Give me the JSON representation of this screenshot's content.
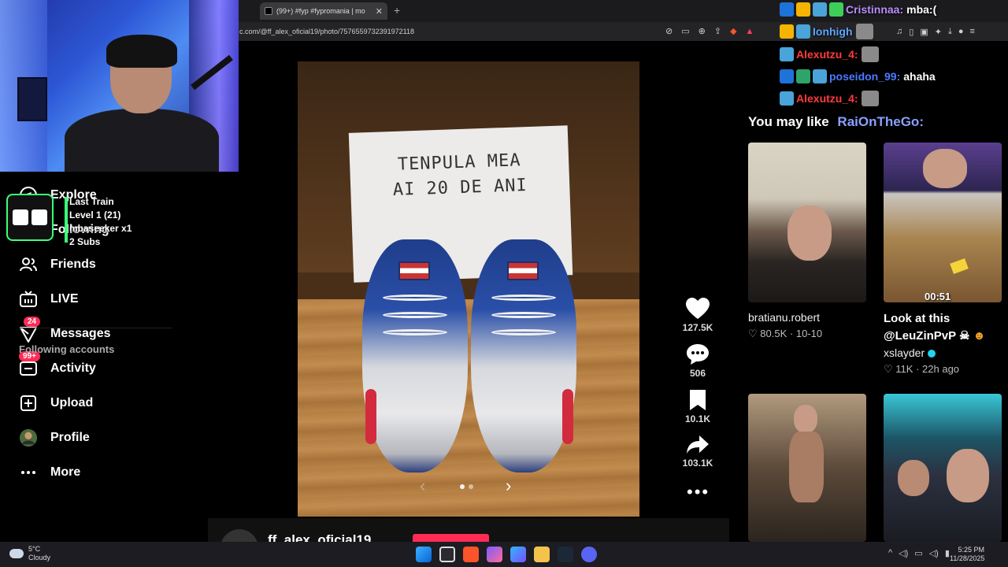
{
  "browser": {
    "tab_title": "(99+) #fyp #fypromania | mo",
    "tab_close": "✕",
    "new_tab": "+",
    "url": "c.com/@ff_alex_oficial19/photo/7576559732391972118"
  },
  "nav": {
    "items": [
      {
        "label": "Explore",
        "icon": "compass-icon"
      },
      {
        "label": "Following",
        "icon": "following-icon"
      },
      {
        "label": "Friends",
        "icon": "friends-icon"
      },
      {
        "label": "LIVE",
        "icon": "live-icon"
      },
      {
        "label": "Messages",
        "icon": "messages-icon",
        "badge": "24"
      },
      {
        "label": "Activity",
        "icon": "activity-icon",
        "badge": "99+"
      },
      {
        "label": "Upload",
        "icon": "upload-icon"
      },
      {
        "label": "Profile",
        "icon": "profile-avatar"
      },
      {
        "label": "More",
        "icon": "more-icon"
      }
    ],
    "following_accounts": "Following accounts"
  },
  "alert": {
    "line1": "Last Train",
    "line2": "Level 1 (21)",
    "line3": "mbaseeker x1",
    "line4": "2 Subs"
  },
  "post": {
    "sign_line1": "TENPULA MEA",
    "sign_line2": "AI 20 DE ANI",
    "likes": "127.5K",
    "comments": "506",
    "saves": "10.1K",
    "shares": "103.1K",
    "author": "ff_alex_oficial19",
    "photo_index": 1,
    "photo_count": 2
  },
  "chat": [
    {
      "user": "Cristinnaa:",
      "msg": "mba:(",
      "color": "#b98cff"
    },
    {
      "user": "Ionhigh",
      "msg": "",
      "color": "#5ea4ff"
    },
    {
      "user": "Alexutzu_4:",
      "msg": "",
      "color": "#ff3b3b"
    },
    {
      "user": "poseidon_99:",
      "msg": "ahaha",
      "color": "#4a7bff"
    },
    {
      "user": "Alexutzu_4:",
      "msg": "",
      "color": "#ff3b3b"
    }
  ],
  "recommendations": {
    "title": "You may like",
    "chat_overlay_user": "RaiOnTheGo:",
    "items": [
      {
        "author": "bratianu.robert",
        "likes": "80.5K",
        "date": "10-10"
      },
      {
        "title_line1": "Look at this",
        "title_line2": "@LeuZinPvP",
        "author": "xslayder",
        "likes": "11K",
        "date": "22h ago",
        "duration": "00:51"
      },
      {},
      {}
    ]
  },
  "taskbar": {
    "temp": "5°C",
    "weather": "Cloudy",
    "time": "5:25 PM",
    "date": "11/28/2025"
  },
  "colors": {
    "accent": "#fe2c55",
    "badge": "#fe2c55",
    "alert_green": "#3dff7a"
  }
}
